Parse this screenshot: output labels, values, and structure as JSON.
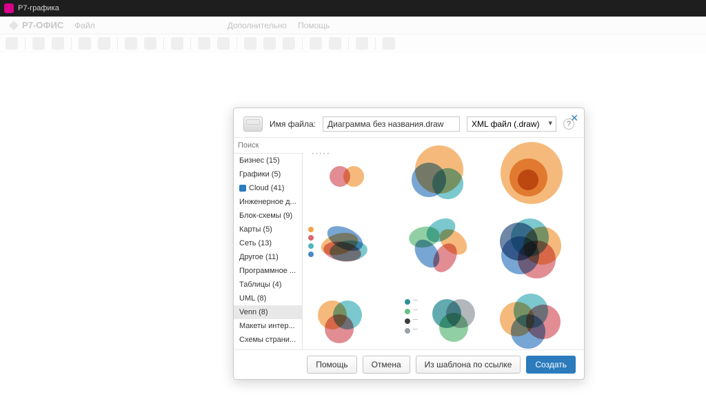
{
  "titlebar": {
    "title": "Р7-графика"
  },
  "brandbar": {
    "logo": "Р7-ОФИС",
    "menus": {
      "file": "Файл",
      "extra": "Дополнительно",
      "help": "Помощь"
    }
  },
  "dialog": {
    "filename_label": "Имя файла:",
    "filename_value": "Диаграмма без названия.draw",
    "filetype_value": "XML файл (.draw)",
    "search_placeholder": "Поиск",
    "categories": [
      {
        "label": "Бизнес (15)"
      },
      {
        "label": "Графики (5)"
      },
      {
        "label": "Cloud (41)",
        "cloud": true
      },
      {
        "label": "Инженерное д..."
      },
      {
        "label": "Блок-схемы (9)"
      },
      {
        "label": "Карты (5)"
      },
      {
        "label": "Сеть (13)"
      },
      {
        "label": "Другое (11)"
      },
      {
        "label": "Программное ..."
      },
      {
        "label": "Таблицы (4)"
      },
      {
        "label": "UML (8)"
      },
      {
        "label": "Venn (8)",
        "selected": true
      },
      {
        "label": "Макеты интер..."
      },
      {
        "label": "Схемы страни..."
      }
    ],
    "buttons": {
      "help": "Помощь",
      "cancel": "Отмена",
      "from_url": "Из шаблона по ссылке",
      "create": "Создать"
    }
  },
  "colors": {
    "orange": "#f2a34f",
    "teal": "#4fb6bf",
    "blue": "#4a88c6",
    "red": "#d7666f",
    "green": "#6abf84",
    "navy": "#3d5f8a",
    "grey": "#9aa0a6",
    "dteal": "#2b8f96"
  }
}
